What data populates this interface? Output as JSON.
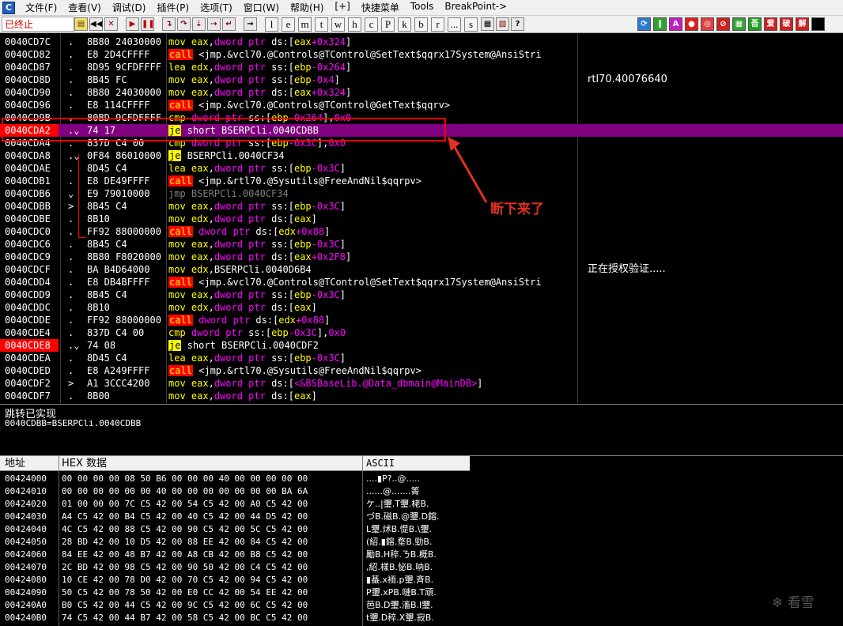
{
  "menubar": {
    "items": [
      "文件(F)",
      "查看(V)",
      "调试(D)",
      "插件(P)",
      "选项(T)",
      "窗口(W)",
      "帮助(H)",
      "[+]",
      "快捷菜单",
      "Tools",
      "BreakPoint->"
    ]
  },
  "toolbar": {
    "status": "已终止",
    "letter_buttons": [
      "l",
      "e",
      "m",
      "t",
      "w",
      "h",
      "c",
      "P",
      "k",
      "b",
      "r",
      "...",
      "s"
    ],
    "plugin_buttons": [
      "A",
      "吾",
      "爱",
      "破",
      "解"
    ]
  },
  "cpu": {
    "rows": [
      {
        "addr": "0040CD7C",
        "mark": ".",
        "hex": "8B80 24030000",
        "asm": [
          [
            "mn",
            "mov "
          ],
          [
            "reg",
            "eax"
          ],
          [
            "sym",
            ","
          ],
          [
            "kw",
            "dword ptr "
          ],
          [
            "sym",
            "ds:["
          ],
          [
            "reg",
            "eax"
          ],
          [
            "num",
            "+0x324"
          ],
          [
            "sym",
            "]"
          ]
        ],
        "comment": ""
      },
      {
        "addr": "0040CD82",
        "mark": ".",
        "hex": "E8 2D4CFFFF",
        "asm": [
          [
            "call",
            "call"
          ],
          [
            "sym",
            " <jmp.&vcl70.@Controls@TControl@SetText$qqrx17System@AnsiStri"
          ]
        ],
        "comment": ""
      },
      {
        "addr": "0040CD87",
        "mark": ".",
        "hex": "8D95 9CFDFFFF",
        "asm": [
          [
            "mn",
            "lea "
          ],
          [
            "reg",
            "edx"
          ],
          [
            "sym",
            ","
          ],
          [
            "kw",
            "dword ptr "
          ],
          [
            "sym",
            "ss:["
          ],
          [
            "reg",
            "ebp"
          ],
          [
            "num",
            "-0x264"
          ],
          [
            "sym",
            "]"
          ]
        ],
        "comment": ""
      },
      {
        "addr": "0040CD8D",
        "mark": ".",
        "hex": "8B45 FC",
        "asm": [
          [
            "mn",
            "mov "
          ],
          [
            "reg",
            "eax"
          ],
          [
            "sym",
            ","
          ],
          [
            "kw",
            "dword ptr "
          ],
          [
            "sym",
            "ss:["
          ],
          [
            "reg",
            "ebp"
          ],
          [
            "num",
            "-0x4"
          ],
          [
            "sym",
            "]"
          ]
        ],
        "comment": "rtl70.40076640"
      },
      {
        "addr": "0040CD90",
        "mark": ".",
        "hex": "8B80 24030000",
        "asm": [
          [
            "mn",
            "mov "
          ],
          [
            "reg",
            "eax"
          ],
          [
            "sym",
            ","
          ],
          [
            "kw",
            "dword ptr "
          ],
          [
            "sym",
            "ds:["
          ],
          [
            "reg",
            "eax"
          ],
          [
            "num",
            "+0x324"
          ],
          [
            "sym",
            "]"
          ]
        ],
        "comment": ""
      },
      {
        "addr": "0040CD96",
        "mark": ".",
        "hex": "E8 114CFFFF",
        "asm": [
          [
            "call",
            "call"
          ],
          [
            "sym",
            " <jmp.&vcl70.@Controls@TControl@GetText$qqrv>"
          ]
        ],
        "comment": ""
      },
      {
        "addr": "0040CD9B",
        "mark": ".",
        "hex": "80BD 9CFDFFFF",
        "asm": [
          [
            "mn",
            "cmp "
          ],
          [
            "kw",
            "dword ptr "
          ],
          [
            "sym",
            "ss:["
          ],
          [
            "reg",
            "ebp"
          ],
          [
            "num",
            "-0x264"
          ],
          [
            "sym",
            "],"
          ],
          [
            "num",
            "0x0"
          ]
        ],
        "comment": ""
      },
      {
        "addr": "0040CDA2",
        "mark": ".⌄",
        "hex": "74 17",
        "asm": [
          [
            "j",
            "je"
          ],
          [
            "sym",
            " short BSERPCli.0040CDBB"
          ]
        ],
        "comment": "",
        "selected": true,
        "bp": true
      },
      {
        "addr": "0040CDA4",
        "mark": ".",
        "hex": "837D C4 00",
        "asm": [
          [
            "mn",
            "cmp "
          ],
          [
            "kw",
            "dword ptr "
          ],
          [
            "sym",
            "ss:["
          ],
          [
            "reg",
            "ebp"
          ],
          [
            "num",
            "-0x3C"
          ],
          [
            "sym",
            "],"
          ],
          [
            "num",
            "0x0"
          ]
        ],
        "comment": ""
      },
      {
        "addr": "0040CDA8",
        "mark": ".⌄",
        "hex": "0F84 86010000",
        "asm": [
          [
            "j",
            "je"
          ],
          [
            "sym",
            " BSERPCli.0040CF34"
          ]
        ],
        "comment": ""
      },
      {
        "addr": "0040CDAE",
        "mark": ".",
        "hex": "8D45 C4",
        "asm": [
          [
            "mn",
            "lea "
          ],
          [
            "reg",
            "eax"
          ],
          [
            "sym",
            ","
          ],
          [
            "kw",
            "dword ptr "
          ],
          [
            "sym",
            "ss:["
          ],
          [
            "reg",
            "ebp"
          ],
          [
            "num",
            "-0x3C"
          ],
          [
            "sym",
            "]"
          ]
        ],
        "comment": ""
      },
      {
        "addr": "0040CDB1",
        "mark": ".",
        "hex": "E8 DE49FFFF",
        "asm": [
          [
            "call",
            "call"
          ],
          [
            "sym",
            " <jmp.&rtl70.@Sysutils@FreeAndNil$qqrpv>"
          ]
        ],
        "comment": ""
      },
      {
        "addr": "0040CDB6",
        "mark": "⌄",
        "hex": "E9 79010000",
        "asm": [
          [
            "jmp",
            "jmp BSERPCli.0040CF34"
          ]
        ],
        "comment": ""
      },
      {
        "addr": "0040CDBB",
        "mark": ">",
        "hex": "8B45 C4",
        "asm": [
          [
            "mn",
            "mov "
          ],
          [
            "reg",
            "eax"
          ],
          [
            "sym",
            ","
          ],
          [
            "kw",
            "dword ptr "
          ],
          [
            "sym",
            "ss:["
          ],
          [
            "reg",
            "ebp"
          ],
          [
            "num",
            "-0x3C"
          ],
          [
            "sym",
            "]"
          ]
        ],
        "comment": ""
      },
      {
        "addr": "0040CDBE",
        "mark": ".",
        "hex": "8B10",
        "asm": [
          [
            "mn",
            "mov "
          ],
          [
            "reg",
            "edx"
          ],
          [
            "sym",
            ","
          ],
          [
            "kw",
            "dword ptr "
          ],
          [
            "sym",
            "ds:["
          ],
          [
            "reg",
            "eax"
          ],
          [
            "sym",
            "]"
          ]
        ],
        "comment": ""
      },
      {
        "addr": "0040CDC0",
        "mark": ".",
        "hex": "FF92 88000000",
        "asm": [
          [
            "call",
            "call"
          ],
          [
            "sym",
            " "
          ],
          [
            "kw",
            "dword ptr "
          ],
          [
            "sym",
            "ds:["
          ],
          [
            "reg",
            "edx"
          ],
          [
            "num",
            "+0x88"
          ],
          [
            "sym",
            "]"
          ]
        ],
        "comment": ""
      },
      {
        "addr": "0040CDC6",
        "mark": ".",
        "hex": "8B45 C4",
        "asm": [
          [
            "mn",
            "mov "
          ],
          [
            "reg",
            "eax"
          ],
          [
            "sym",
            ","
          ],
          [
            "kw",
            "dword ptr "
          ],
          [
            "sym",
            "ss:["
          ],
          [
            "reg",
            "ebp"
          ],
          [
            "num",
            "-0x3C"
          ],
          [
            "sym",
            "]"
          ]
        ],
        "comment": ""
      },
      {
        "addr": "0040CDC9",
        "mark": ".",
        "hex": "8B80 F8020000",
        "asm": [
          [
            "mn",
            "mov "
          ],
          [
            "reg",
            "eax"
          ],
          [
            "sym",
            ","
          ],
          [
            "kw",
            "dword ptr "
          ],
          [
            "sym",
            "ds:["
          ],
          [
            "reg",
            "eax"
          ],
          [
            "num",
            "+0x2F8"
          ],
          [
            "sym",
            "]"
          ]
        ],
        "comment": ""
      },
      {
        "addr": "0040CDCF",
        "mark": ".",
        "hex": "BA B4D64000",
        "asm": [
          [
            "mn",
            "mov "
          ],
          [
            "reg",
            "edx"
          ],
          [
            "sym",
            ",BSERPCli.0040D6B4"
          ]
        ],
        "comment": "正在授权验证....."
      },
      {
        "addr": "0040CDD4",
        "mark": ".",
        "hex": "E8 DB4BFFFF",
        "asm": [
          [
            "call",
            "call"
          ],
          [
            "sym",
            " <jmp.&vcl70.@Controls@TControl@SetText$qqrx17System@AnsiStri"
          ]
        ],
        "comment": ""
      },
      {
        "addr": "0040CDD9",
        "mark": ".",
        "hex": "8B45 C4",
        "asm": [
          [
            "mn",
            "mov "
          ],
          [
            "reg",
            "eax"
          ],
          [
            "sym",
            ","
          ],
          [
            "kw",
            "dword ptr "
          ],
          [
            "sym",
            "ss:["
          ],
          [
            "reg",
            "ebp"
          ],
          [
            "num",
            "-0x3C"
          ],
          [
            "sym",
            "]"
          ]
        ],
        "comment": ""
      },
      {
        "addr": "0040CDDC",
        "mark": ".",
        "hex": "8B10",
        "asm": [
          [
            "mn",
            "mov "
          ],
          [
            "reg",
            "edx"
          ],
          [
            "sym",
            ","
          ],
          [
            "kw",
            "dword ptr "
          ],
          [
            "sym",
            "ds:["
          ],
          [
            "reg",
            "eax"
          ],
          [
            "sym",
            "]"
          ]
        ],
        "comment": ""
      },
      {
        "addr": "0040CDDE",
        "mark": ".",
        "hex": "FF92 88000000",
        "asm": [
          [
            "call",
            "call"
          ],
          [
            "sym",
            " "
          ],
          [
            "kw",
            "dword ptr "
          ],
          [
            "sym",
            "ds:["
          ],
          [
            "reg",
            "edx"
          ],
          [
            "num",
            "+0x88"
          ],
          [
            "sym",
            "]"
          ]
        ],
        "comment": ""
      },
      {
        "addr": "0040CDE4",
        "mark": ".",
        "hex": "837D C4 00",
        "asm": [
          [
            "mn",
            "cmp "
          ],
          [
            "kw",
            "dword ptr "
          ],
          [
            "sym",
            "ss:["
          ],
          [
            "reg",
            "ebp"
          ],
          [
            "num",
            "-0x3C"
          ],
          [
            "sym",
            "],"
          ],
          [
            "num",
            "0x0"
          ]
        ],
        "comment": ""
      },
      {
        "addr": "0040CDE8",
        "mark": ".⌄",
        "hex": "74 08",
        "asm": [
          [
            "j",
            "je"
          ],
          [
            "sym",
            " short BSERPCli.0040CDF2"
          ]
        ],
        "comment": "",
        "bp": true
      },
      {
        "addr": "0040CDEA",
        "mark": ".",
        "hex": "8D45 C4",
        "asm": [
          [
            "mn",
            "lea "
          ],
          [
            "reg",
            "eax"
          ],
          [
            "sym",
            ","
          ],
          [
            "kw",
            "dword ptr "
          ],
          [
            "sym",
            "ss:["
          ],
          [
            "reg",
            "ebp"
          ],
          [
            "num",
            "-0x3C"
          ],
          [
            "sym",
            "]"
          ]
        ],
        "comment": ""
      },
      {
        "addr": "0040CDED",
        "mark": ".",
        "hex": "E8 A249FFFF",
        "asm": [
          [
            "call",
            "call"
          ],
          [
            "sym",
            " <jmp.&rtl70.@Sysutils@FreeAndNil$qqrpv>"
          ]
        ],
        "comment": ""
      },
      {
        "addr": "0040CDF2",
        "mark": ">",
        "hex": "A1 3CCC4200",
        "asm": [
          [
            "mn",
            "mov "
          ],
          [
            "reg",
            "eax"
          ],
          [
            "sym",
            ","
          ],
          [
            "kw",
            "dword ptr "
          ],
          [
            "sym",
            "ds:["
          ],
          [
            "kw",
            "<&BSBaseLib.@Data_dbmain@MainDB>"
          ],
          [
            "sym",
            "]"
          ]
        ],
        "comment": ""
      },
      {
        "addr": "0040CDF7",
        "mark": ".",
        "hex": "8B00",
        "asm": [
          [
            "mn",
            "mov "
          ],
          [
            "reg",
            "eax"
          ],
          [
            "sym",
            ","
          ],
          [
            "kw",
            "dword ptr "
          ],
          [
            "sym",
            "ds:["
          ],
          [
            "reg",
            "eax"
          ],
          [
            "sym",
            "]"
          ]
        ],
        "comment": ""
      }
    ]
  },
  "annotation": {
    "text": "断下来了",
    "color": "#e03020"
  },
  "info": {
    "line1": "跳转已实现",
    "line2": "0040CDBB=BSERPCli.0040CDBB"
  },
  "dump": {
    "header_addr": "地址",
    "header_hex": "HEX 数据",
    "header_ascii": "ASCII",
    "rows": [
      {
        "addr": "00424000",
        "hex": "00 00 00 00|08 50 B6 00|00 00 40 00|00 00 00 00",
        "ascii": "....▮P?..@....."
      },
      {
        "addr": "00424010",
        "hex": "00 00 00 00|00 00 40 00|00 00 00 00|00 00 BA 6A",
        "ascii": "......@.......箐"
      },
      {
        "addr": "00424020",
        "hex": "01 00 00 00|7C C5 42 00|54 C5 42 00|A0 C5 42 00",
        "ascii": "ケ..|瓕.T瓕.栳B."
      },
      {
        "addr": "00424030",
        "hex": "A4 C5 42 00|B4 C5 42 00|40 C5 42 00|44 D5 42 00",
        "ascii": "づB.磁B.@瓕.D鎔."
      },
      {
        "addr": "00424040",
        "hex": "4C C5 42 00|88 C5 42 00|90 C5 42 00|5C C5 42 00",
        "ascii": "L瓕.炢B.惿B.\\瓕."
      },
      {
        "addr": "00424050",
        "hex": "28 BD 42 00|10 D5 42 00|88 EE 42 00|84 C5 42 00",
        "ascii": "(紹.▮鎔.堥B.勁B."
      },
      {
        "addr": "00424060",
        "hex": "84 EE 42 00|48 B7 42 00|A8 CB 42 00|B8 C5 42 00",
        "ascii": "勵B.H稡.ㄋB.概B."
      },
      {
        "addr": "00424070",
        "hex": "2C BD 42 00|98 C5 42 00|90 50 42 00|C4 C5 42 00",
        "ascii": ",紹.樣B.怭B.呐B."
      },
      {
        "addr": "00424080",
        "hex": "10 CE 42 00|78 D0 42 00|70 C5 42 00|94 C5 42 00",
        "ascii": "▮蜝.x袻.p瓕.斉B."
      },
      {
        "addr": "00424090",
        "hex": "50 C5 42 00|78 50 42 00|E0 CC 42 00|54 EE 42 00",
        "ascii": "P瓕.xPB.嗹B.T頑."
      },
      {
        "addr": "004240A0",
        "hex": "B0 C5 42 00|44 C5 42 00|9C C5 42 00|6C C5 42 00",
        "ascii": "芭B.D瓕.滀B.l瓕."
      },
      {
        "addr": "004240B0",
        "hex": "74 C5 42 00|44 B7 42 00|58 C5 42 00|BC C5 42 00",
        "ascii": "t瓕.D稡.X瓕.寂B."
      }
    ]
  },
  "watermark": "看雪"
}
